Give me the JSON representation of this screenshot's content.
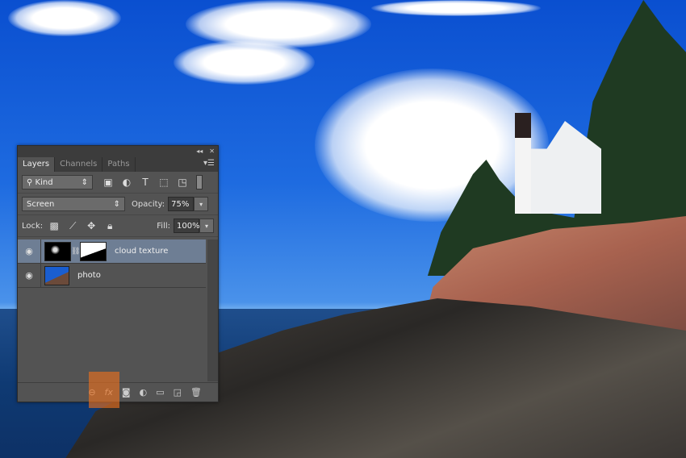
{
  "panel": {
    "tabs": [
      {
        "label": "Layers",
        "active": true
      },
      {
        "label": "Channels",
        "active": false
      },
      {
        "label": "Paths",
        "active": false
      }
    ],
    "filter_kind": "Kind",
    "blend_mode": "Screen",
    "opacity_label": "Opacity:",
    "opacity_value": "75%",
    "lock_label": "Lock:",
    "fill_label": "Fill:",
    "fill_value": "100%",
    "layers": [
      {
        "name": "cloud texture",
        "visible": true,
        "selected": true,
        "has_mask": true
      },
      {
        "name": "photo",
        "visible": true,
        "selected": false,
        "has_mask": false
      }
    ],
    "bottom_icons": [
      "link-icon",
      "fx-icon",
      "add-mask-icon",
      "adjustment-icon",
      "folder-icon",
      "new-layer-icon",
      "trash-icon"
    ],
    "fx_label": "fx",
    "highlight_color": "#e06e1e"
  }
}
